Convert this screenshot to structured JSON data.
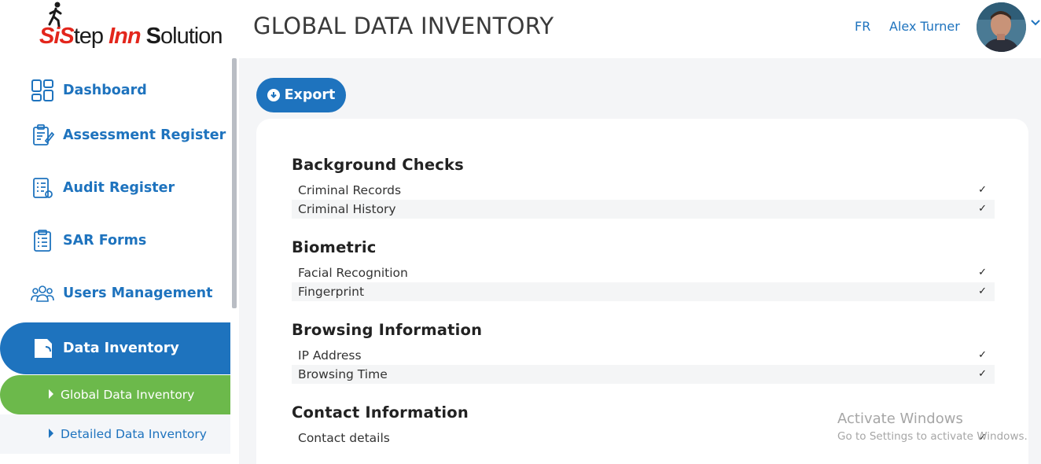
{
  "header": {
    "logo": {
      "brand_prefix": "S",
      "brand_prefix2": "i",
      "brand_step": "Step ",
      "brand_inn": "Inn ",
      "brand_s": "S",
      "brand_solution": "olution"
    },
    "title": "GLOBAL DATA INVENTORY",
    "language": "FR",
    "user_name": "Alex Turner"
  },
  "sidebar": {
    "items": [
      {
        "label": "Dashboard",
        "icon": "dashboard-icon"
      },
      {
        "label": "Assessment Register",
        "icon": "clipboard-pencil-icon"
      },
      {
        "label": "Audit Register",
        "icon": "checklist-icon"
      },
      {
        "label": "SAR Forms",
        "icon": "clipboard-list-icon"
      },
      {
        "label": "Users Management",
        "icon": "users-icon"
      },
      {
        "label": "Data Inventory",
        "icon": "sd-card-icon",
        "active": true
      }
    ],
    "sub_items": [
      {
        "label": "Global Data Inventory",
        "active": true
      },
      {
        "label": "Detailed Data Inventory"
      }
    ]
  },
  "toolbar": {
    "export_label": "Export"
  },
  "inventory": [
    {
      "title": "Background Checks",
      "rows": [
        {
          "label": "Criminal Records",
          "check": "✓"
        },
        {
          "label": "Criminal History",
          "check": "✓"
        }
      ]
    },
    {
      "title": "Biometric",
      "rows": [
        {
          "label": "Facial Recognition",
          "check": "✓"
        },
        {
          "label": "Fingerprint",
          "check": "✓"
        }
      ]
    },
    {
      "title": "Browsing Information",
      "rows": [
        {
          "label": "IP Address",
          "check": "✓"
        },
        {
          "label": "Browsing Time",
          "check": "✓"
        }
      ]
    },
    {
      "title": "Contact Information",
      "rows": [
        {
          "label": "Contact details",
          "check": "✓"
        }
      ]
    }
  ],
  "watermark": {
    "line1": "Activate Windows",
    "line2": "Go to Settings to activate Windows."
  },
  "colors": {
    "accent": "#1e73be",
    "active_sub": "#6cb94b",
    "logo_red": "#e3261c"
  }
}
